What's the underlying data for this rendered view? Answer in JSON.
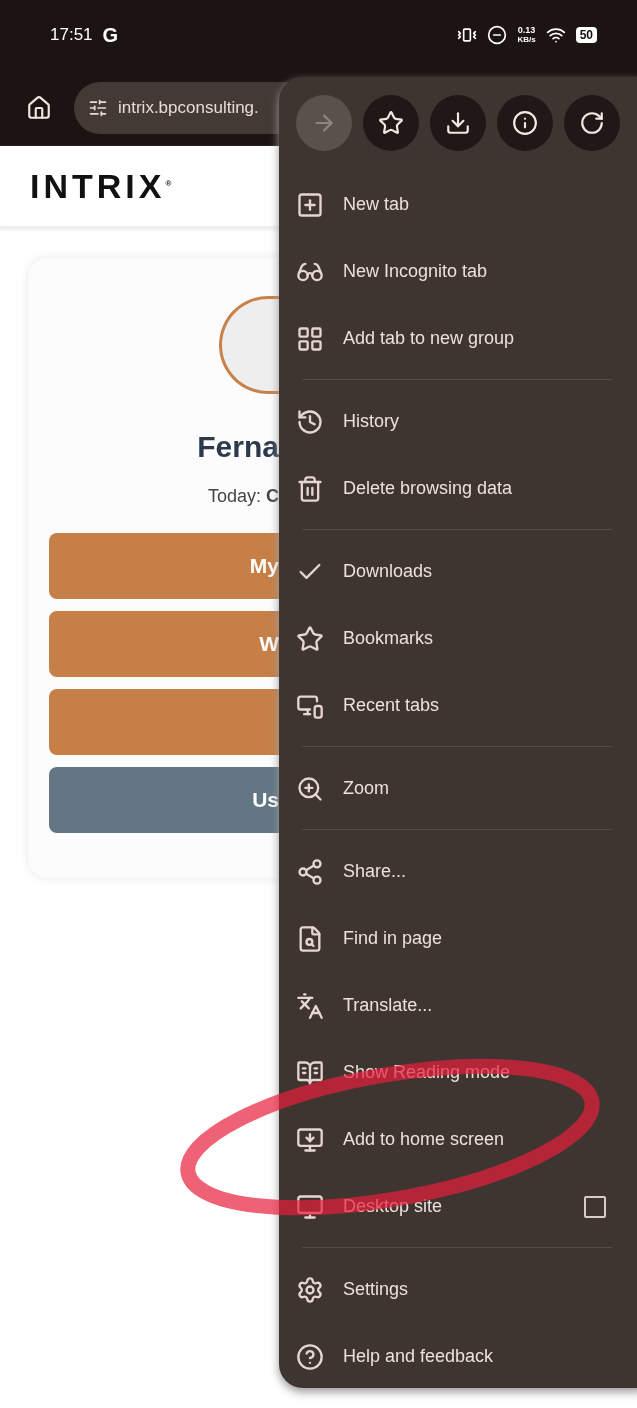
{
  "status_bar": {
    "time": "17:51",
    "app_letter": "G",
    "network_speed": "0.13",
    "network_unit": "KB/s",
    "battery": "50"
  },
  "address_bar": {
    "url": "intrix.bpconsulting."
  },
  "page": {
    "logo": "INTRIX",
    "logo_mark": "®",
    "name": "Ferna",
    "date_label": "Today: ",
    "date_value": "C",
    "buttons": [
      {
        "label": "My",
        "kind": "primary"
      },
      {
        "label": "W",
        "kind": "primary"
      },
      {
        "kind": "primary"
      },
      {
        "label": "Us",
        "kind": "secondary"
      }
    ]
  },
  "menu": {
    "actions": [
      {
        "disabled": true
      },
      {
        "disabled": false
      },
      {
        "disabled": false
      },
      {
        "disabled": false
      },
      {
        "disabled": false
      }
    ],
    "groups": [
      [
        {
          "label": "New tab"
        },
        {
          "label": "New Incognito tab"
        },
        {
          "label": "Add tab to new group"
        }
      ],
      [
        {
          "label": "History"
        },
        {
          "label": "Delete browsing data"
        }
      ],
      [
        {
          "label": "Downloads"
        },
        {
          "label": "Bookmarks"
        },
        {
          "label": "Recent tabs"
        }
      ],
      [
        {
          "label": "Zoom"
        }
      ],
      [
        {
          "label": "Share..."
        },
        {
          "label": "Find in page"
        },
        {
          "label": "Translate..."
        },
        {
          "label": "Show Reading mode"
        },
        {
          "label": "Add to home screen"
        },
        {
          "label": "Desktop site",
          "checked": false
        }
      ],
      [
        {
          "label": "Settings"
        },
        {
          "label": "Help and feedback"
        }
      ]
    ]
  }
}
